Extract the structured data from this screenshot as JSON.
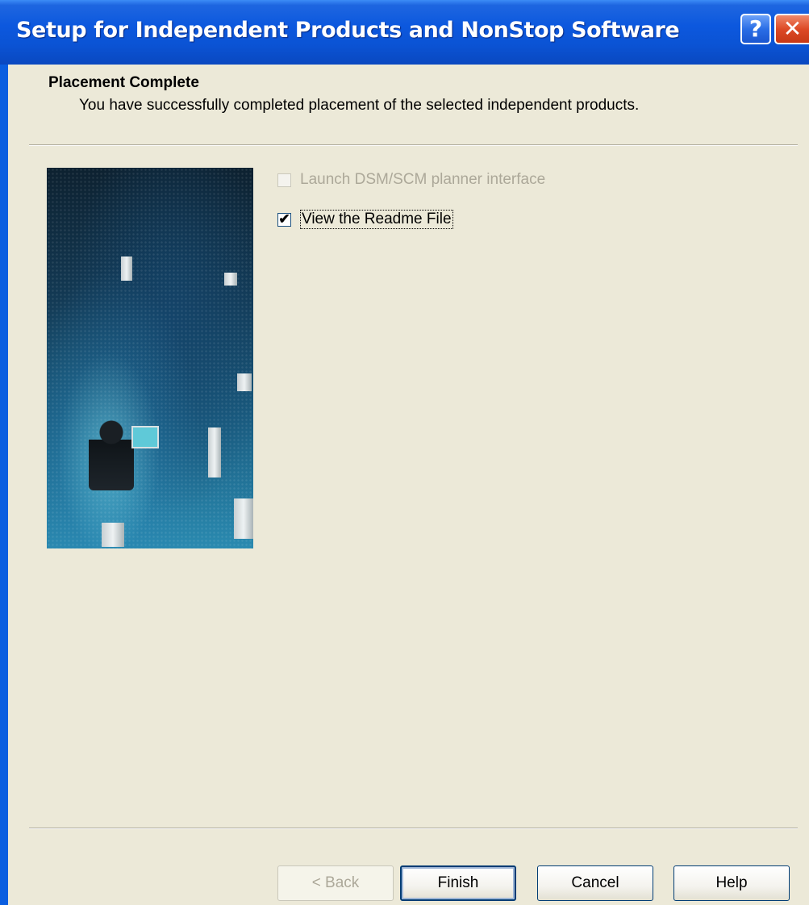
{
  "window": {
    "title": "Setup for Independent Products and NonStop Software",
    "help_glyph": "?",
    "close_glyph": "✕"
  },
  "header": {
    "title": "Placement Complete",
    "subtitle": "You have successfully completed placement of the selected independent products."
  },
  "options": [
    {
      "label": "Launch DSM/SCM planner interface",
      "checked": false,
      "enabled": false
    },
    {
      "label": "View the Readme File",
      "checked": true,
      "enabled": true
    }
  ],
  "buttons": {
    "back": "< Back",
    "finish": "Finish",
    "cancel": "Cancel",
    "help": "Help"
  },
  "colors": {
    "titlebar": "#0b53d4",
    "dialog_background": "#ece9d8",
    "close_button": "#dd4a26",
    "disabled_text": "#aca899"
  },
  "icons": {
    "help": "help-question-icon",
    "close": "close-icon",
    "checkmark": "checkmark-icon"
  }
}
